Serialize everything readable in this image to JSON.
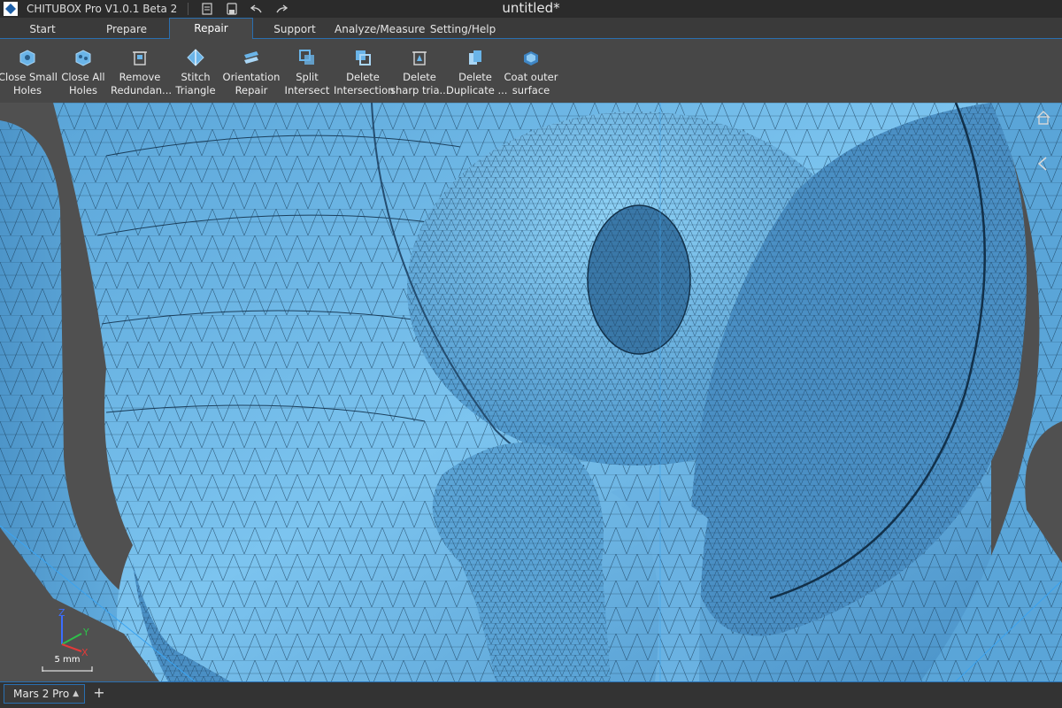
{
  "titlebar": {
    "app_name": "CHITUBOX Pro V1.0.1 Beta 2",
    "document_title": "untitled*",
    "icons": [
      "logo-icon",
      "document-list-icon",
      "save-icon",
      "undo-icon",
      "redo-icon"
    ]
  },
  "tabs": [
    {
      "label": "Start",
      "active": false
    },
    {
      "label": "Prepare",
      "active": false
    },
    {
      "label": "Repair",
      "active": true
    },
    {
      "label": "Support",
      "active": false
    },
    {
      "label": "Analyze/Measure",
      "active": false
    },
    {
      "label": "Setting/Help",
      "active": false
    }
  ],
  "tools": [
    {
      "line1": "Close  Small",
      "line2": "Holes",
      "icon": "close-small-holes-icon"
    },
    {
      "line1": "Close All",
      "line2": "Holes",
      "icon": "close-all-holes-icon"
    },
    {
      "line1": "Remove",
      "line2": "Redundan...",
      "icon": "remove-redundant-icon"
    },
    {
      "line1": "Stitch",
      "line2": "Triangle",
      "icon": "stitch-triangle-icon"
    },
    {
      "line1": "Orientation",
      "line2": "Repair",
      "icon": "orientation-repair-icon"
    },
    {
      "line1": "Split",
      "line2": "Intersect",
      "icon": "split-intersect-icon"
    },
    {
      "line1": "Delete",
      "line2": "Intersection",
      "icon": "delete-intersection-icon"
    },
    {
      "line1": "Delete",
      "line2": "sharp tria...",
      "icon": "delete-sharp-triangles-icon"
    },
    {
      "line1": "Delete",
      "line2": "Duplicate ...",
      "icon": "delete-duplicate-icon"
    },
    {
      "line1": "Coat outer",
      "line2": "surface",
      "icon": "coat-outer-surface-icon"
    }
  ],
  "viewport": {
    "mesh_color": "#5aa9dc",
    "background_color": "#505050",
    "axis": {
      "x": "X",
      "y": "Y",
      "z": "Z"
    },
    "scale_label": "5 mm"
  },
  "bottombar": {
    "printer": "Mars 2 Pro",
    "add_label": "+"
  },
  "colors": {
    "accent": "#2a6fb0",
    "ribbon_bg": "#474747",
    "titlebar_bg": "#2b2b2b"
  }
}
